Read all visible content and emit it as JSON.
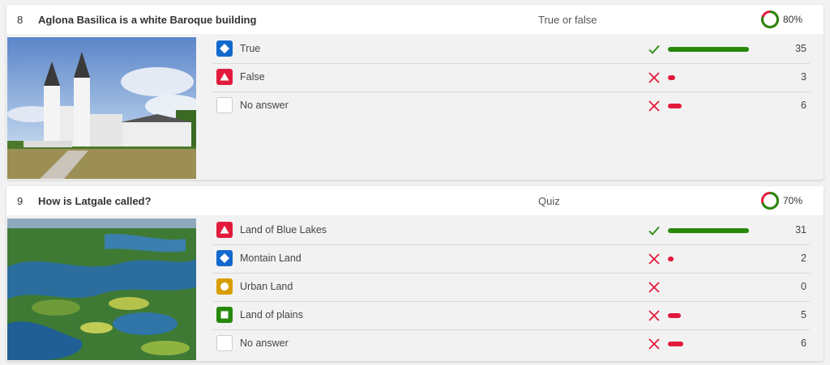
{
  "colors": {
    "diamond_blue": "#1368ce",
    "triangle_red": "#e21b3c",
    "circle_gold": "#d89e00",
    "square_green": "#26890c",
    "correct_green": "#26890c",
    "wrong_red": "#e21b3c",
    "ring_green": "#26890c",
    "ring_red": "#e21b3c"
  },
  "questions": [
    {
      "number": "8",
      "title": "Aglona Basilica is a white Baroque building",
      "type": "True or false",
      "percent_label": "80%",
      "percent_value": 0.8,
      "image_icon": "church-photo",
      "answers": [
        {
          "shape": "diamond",
          "label": "True",
          "correct": true,
          "count": "35",
          "value": 35
        },
        {
          "shape": "triangle",
          "label": "False",
          "correct": false,
          "count": "3",
          "value": 3
        },
        {
          "shape": "none",
          "label": "No answer",
          "correct": false,
          "count": "6",
          "value": 6
        }
      ]
    },
    {
      "number": "9",
      "title": "How is Latgale called?",
      "type": "Quiz",
      "percent_label": "70%",
      "percent_value": 0.7,
      "image_icon": "lakes-aerial-photo",
      "answers": [
        {
          "shape": "triangle",
          "label": "Land of Blue Lakes",
          "correct": true,
          "count": "31",
          "value": 31
        },
        {
          "shape": "diamond",
          "label": "Montain Land",
          "correct": false,
          "count": "2",
          "value": 2
        },
        {
          "shape": "circle",
          "label": "Urban Land",
          "correct": false,
          "count": "0",
          "value": 0
        },
        {
          "shape": "square",
          "label": "Land of plains",
          "correct": false,
          "count": "5",
          "value": 5
        },
        {
          "shape": "none",
          "label": "No answer",
          "correct": false,
          "count": "6",
          "value": 6
        }
      ]
    }
  ]
}
